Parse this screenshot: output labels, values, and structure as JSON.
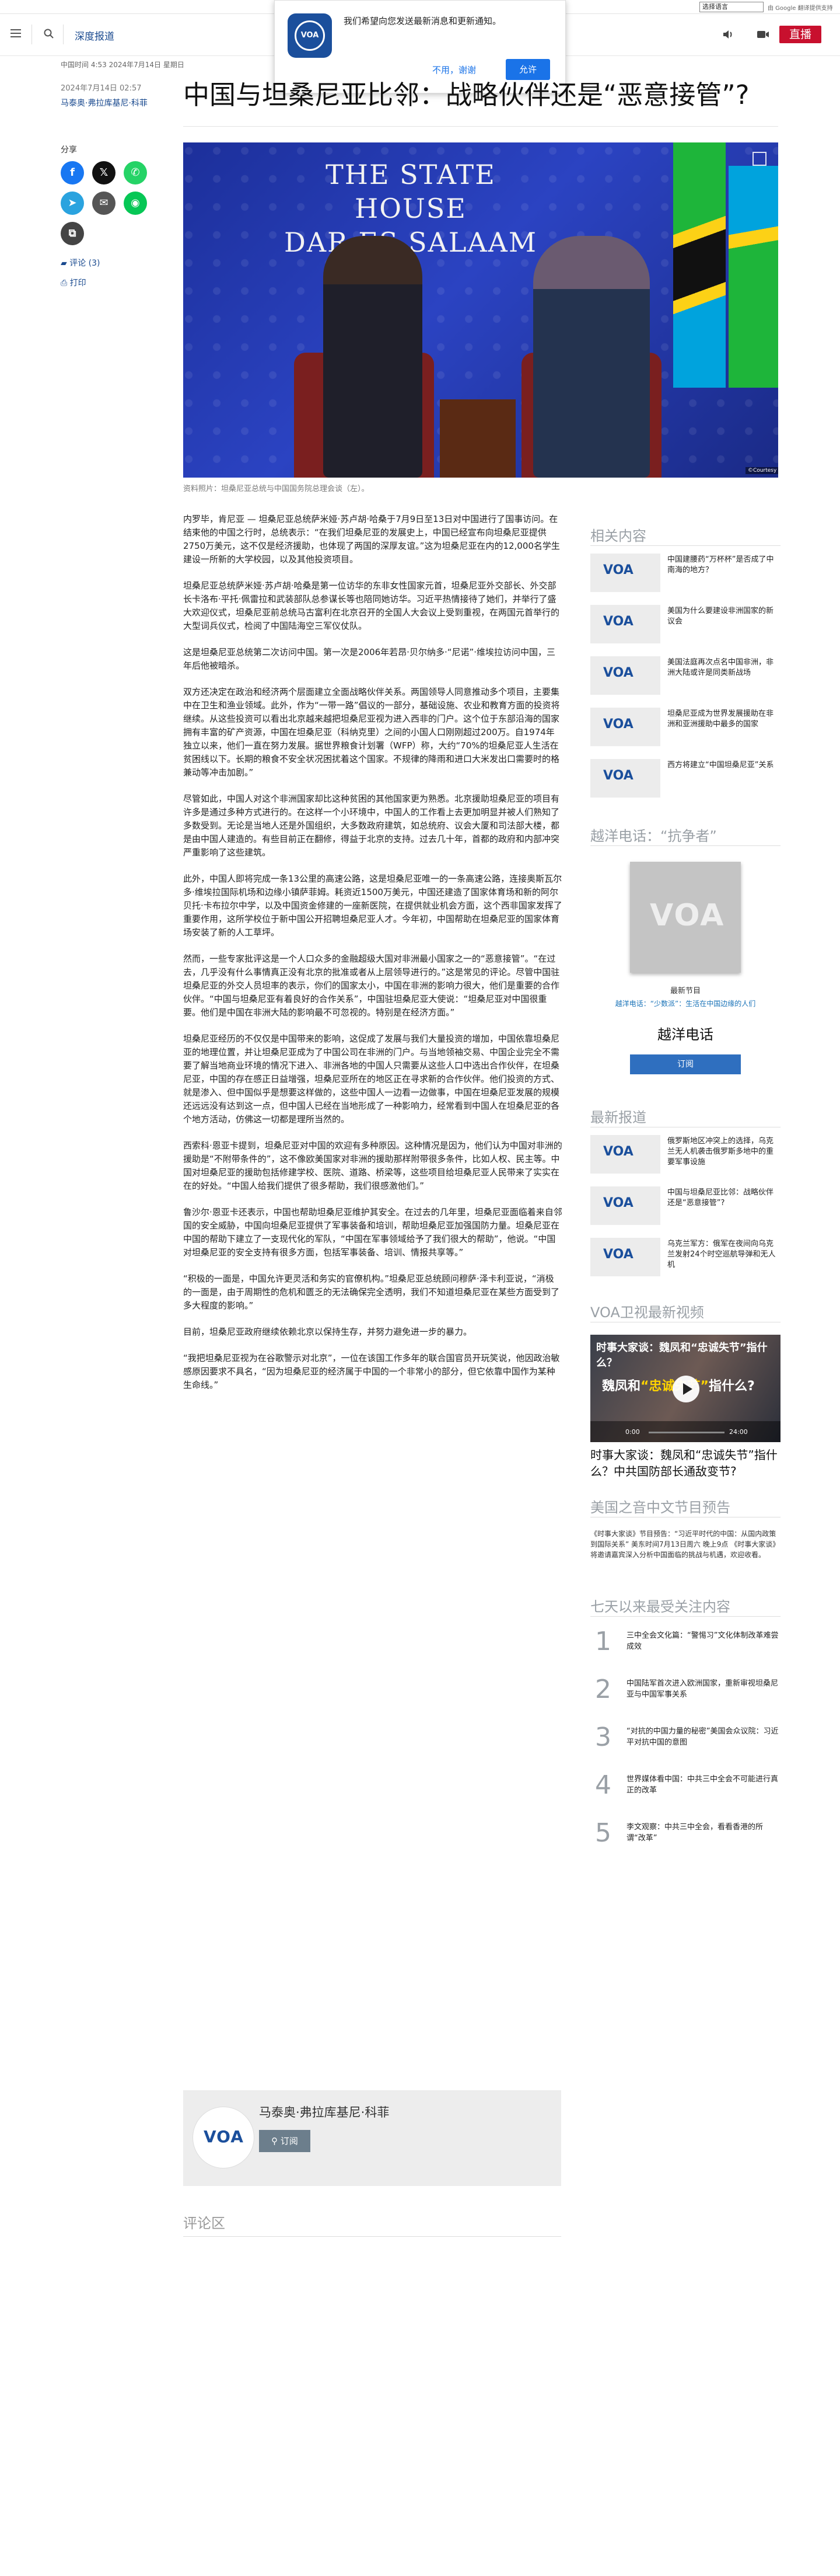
{
  "topbar": {
    "language_select": "选择语言",
    "translate_credit": "由 Google 翻译提供支持"
  },
  "header": {
    "section_label": "深度报道",
    "live_button": "直播"
  },
  "notification": {
    "logo_text": "VOA",
    "message": "我们希望向您发送最新消息和更新通知。",
    "decline": "不用，谢谢",
    "accept": "允许"
  },
  "article": {
    "dateline": "中国时间 4:53 2024年7月14日 星期日",
    "timestamp": "2024年7月14日 02:57",
    "author": "马泰奥·弗拉库基尼·科菲",
    "title": "中国与坦桑尼亚比邻：战略伙伴还是“恶意接管”?",
    "hero_sign_line1": "THE STATE HOUSE",
    "hero_sign_line2": "DAR ES SALAAM",
    "photo_credit": "©Courtesy",
    "caption": "资料照片：坦桑尼亚总统与中国国务院总理会谈（左）。",
    "paragraphs": [
      "内罗毕，肯尼亚 — 坦桑尼亚总统萨米娅·苏卢胡·哈桑于7月9日至13日对中国进行了国事访问。在结束他的中国之行时，总统表示：“在我们坦桑尼亚的发展史上，中国已经宣布向坦桑尼亚提供2750万美元，这不仅是经济援助，也体现了两国的深厚友谊。”这为坦桑尼亚在内的12,000名学生建设一所新的大学校园，以及其他投资项目。",
      "坦桑尼亚总统萨米娅·苏卢胡·哈桑是第一位访华的东非女性国家元首，坦桑尼亚外交部长、外交部长卡洛布·平托·佩雷拉和武装部队总参谋长等也陪同她访华。习近平热情接待了她们，并举行了盛大欢迎仪式，坦桑尼亚前总统马古富利在北京召开的全国人大会议上受到重视，在两国元首举行的大型词兵仪式，检阅了中国陆海空三军仪仗队。",
      "这是坦桑尼亚总统第二次访问中国。第一次是2006年若昂·贝尔纳多·“尼诺”·维埃拉访问中国，三年后他被暗杀。",
      "双方还决定在政治和经济两个层面建立全面战略伙伴关系。两国领导人同意推动多个项目，主要集中在卫生和渔业领域。此外，作为“一带一路”倡议的一部分，基础设施、农业和教育方面的投资将继续。从这些投资可以看出北京越来越把坦桑尼亚视为进入西非的门户。这个位于东部沿海的国家拥有丰富的矿产资源，中国在坦桑尼亚（科纳克里）之间的小国人口刚刚超过200万。自1974年独立以来，他们一直在努力发展。据世界粮食计划署（WFP）称，大约“70%的坦桑尼亚人生活在贫困线以下。长期的粮食不安全状况困扰着这个国家。不规律的降雨和进口大米发出口需要时的格兼动等冲击加剧。”",
      "尽管如此，中国人对这个非洲国家却比这种贫困的其他国家更为熟悉。北京援助坦桑尼亚的项目有许多是通过多种方式进行的。在这样一个小环境中，中国人的工作看上去更加明显并被人们熟知了多数受到。无论是当地人还是外国组织，大多数政府建筑，如总统府、议会大厦和司法部大楼，都是由中国人建造的。有些目前正在翻修，得益于北京的支持。过去几十年，首都的政府和内部冲突严重影响了这些建筑。",
      "此外，中国人即将完成一条13公里的高速公路，这是坦桑尼亚唯一的一条高速公路，连接奥斯瓦尔多·维埃拉国际机场和边缘小镇萨菲姆。耗资近1500万美元，中国还建造了国家体育场和新的阿尔贝托·卡布拉尔中学，以及中国资金修建的一座新医院，在提供就业机会方面，这个西非国家发挥了重要作用，这所学校位于新中国公开招聘坦桑尼亚人才。今年初，中国帮助在坦桑尼亚的国家体育场安装了新的人工草坪。",
      "然而，一些专家批评这是一个人口众多的金融超级大国对非洲最小国家之一的“恶意接管”。“在过去，几乎没有什么事情真正没有北京的批准或者从上层领导进行的。”这是常见的评论。尽管中国驻坦桑尼亚的外交人员坦率的表示，你们的国家太小，中国在非洲的影响力很大，他们是重要的合作伙伴。“中国与坦桑尼亚有着良好的合作关系”，中国驻坦桑尼亚大使说：“坦桑尼亚对中国很重要。他们是中国在非洲大陆的影响最不可忽视的。特别是在经济方面。”",
      "坦桑尼亚经历的不仅仅是中国带来的影响，这促成了发展与我们大量投资的增加，中国依靠坦桑尼亚的地理位置，并让坦桑尼亚成为了中国公司在非洲的门户。与当地领袖交易、中国企业完全不需要了解当地商业环境的情况下进入、非洲各地的中国人只需要从这些人口中选出合作伙伴，在坦桑尼亚，中国的存在感正日益增强，坦桑尼亚所在的地区正在寻求新的合作伙伴。他们投资的方式、就是渗入、但中国似乎是想要这样做的，这些中国人一边看一边做事，中国在坦桑尼亚发展的规模还远远没有达到这一点，但中国人已经在当地形成了一种影响力，经常看到中国人在坦桑尼亚的各个地方活动，仿佛这一切都是理所当然的。",
      "西索科·恩亚卡提到，坦桑尼亚对中国的欢迎有多种原因。这种情况是因为，他们认为中国对非洲的援助是“不附带条件的”，这不像欧美国家对非洲的援助那样附带很多条件，比如人权、民主等。中国对坦桑尼亚的援助包括修建学校、医院、道路、桥梁等，这些项目给坦桑尼亚人民带来了实实在在的好处。“中国人给我们提供了很多帮助，我们很感激他们。”",
      "鲁沙尔·恩亚卡还表示，中国也帮助坦桑尼亚维护其安全。在过去的几年里，坦桑尼亚面临着来自邻国的安全威胁，中国向坦桑尼亚提供了军事装备和培训，帮助坦桑尼亚加强国防力量。坦桑尼亚在中国的帮助下建立了一支现代化的军队，“中国在军事领域给予了我们很大的帮助”，他说。“中国对坦桑尼亚的安全支持有很多方面，包括军事装备、培训、情报共享等。”",
      "“积极的一面是，中国允许更灵活和务实的官僚机构。”坦桑尼亚总统顾问穆萨·泽卡利亚说，“消极的一面是，由于周期性的危机和匮乏的无法确保完全透明，我们不知道坦桑尼亚在某些方面受到了多大程度的影响。”",
      "目前，坦桑尼亚政府继续依赖北京以保持生存，并努力避免进一步的暴力。",
      "“我把坦桑尼亚视为在谷歌警示对北京”，一位在该国工作多年的联合国官员开玩笑说，他因政治敏感原因要求不具名，“因为坦桑尼亚的经济属于中国的一个非常小的部分，但它依靠中国作为某种生命线。”"
    ]
  },
  "share": {
    "label": "分享",
    "comments": "评论 (3)",
    "print": "打印"
  },
  "author_box": {
    "logo_text": "VOA",
    "name": "马泰奥·弗拉库基尼·科菲",
    "subscribe": "订阅"
  },
  "comments_heading": "评论区",
  "rail": {
    "related_heading": "相关内容",
    "related": [
      {
        "thumb": "VOA",
        "text": "中国建腰药“万杯杯”是否成了中南海的地方？"
      },
      {
        "thumb": "VOA",
        "text": "美国为什么要建设非洲国家的新议会"
      },
      {
        "thumb": "VOA",
        "text": "美国法庭再次点名中国非洲，非洲大陆或许是同类新战场"
      },
      {
        "thumb": "VOA",
        "text": "坦桑尼亚成为世界发展援助在非洲和亚洲援助中最多的国家"
      },
      {
        "thumb": "VOA",
        "text": "西方将建立“中国坦桑尼亚”关系"
      }
    ],
    "podcast_heading": "越洋电话：“抗争者”",
    "podcast_logo": "VOA",
    "podcast_label": "最新节目",
    "podcast_link": "越洋电话：“少数派”：生活在中国边缘的人们",
    "podcast_name": "越洋电话",
    "podcast_subscribe": "订阅",
    "latest_heading": "最新报道",
    "latest": [
      {
        "thumb": "VOA",
        "text": "俄罗斯地区冲突上的选择，乌克兰无人机袭击俄罗斯多地中的重要军事设施"
      },
      {
        "thumb": "VOA",
        "text": "中国与坦桑尼亚比邻：战略伙伴还是“恶意接管”?"
      },
      {
        "thumb": "VOA",
        "text": "乌克兰军方：俄军在夜间向乌克兰发射24个时空巡航导弹和无人机"
      }
    ],
    "video_heading": "VOA卫视最新视频",
    "video_overlay": "时事大家谈：魏凤和“忠诚失节”指什么？",
    "video_big_a": "魏凤和",
    "video_big_b": "“忠诚失节”",
    "video_big_c": "指什么?",
    "video_time": "0:00",
    "video_duration": "24:00",
    "video_caption": "时事大家谈：魏凤和“忠诚失节”指什么？中共国防部长通敌变节?",
    "schedule_heading": "美国之音中文节目预告",
    "schedule_text": "《时事大家谈》节目预告：“习近平时代的中国：从国内政策到国际关系” 美东时间7月13日周六 晚上9点 《时事大家谈》将邀请嘉宾深入分析中国面临的挑战与机遇，欢迎收看。",
    "popular_heading": "七天以来最受关注内容",
    "popular": [
      {
        "num": "1",
        "text": "三中全会文化篇：“警惕习”文化体制改革难尝成效"
      },
      {
        "num": "2",
        "text": "中国陆军首次进入欧洲国家，重新审视坦桑尼亚与中国军事关系"
      },
      {
        "num": "3",
        "text": "“对抗的中国力量的秘密”美国会众议院：习近平对抗中国的意图"
      },
      {
        "num": "4",
        "text": "世界媒体看中国：中共三中全会不可能进行真正的改革"
      },
      {
        "num": "5",
        "text": "李文观察：中共三中全会，看看香港的所谓“改革”"
      }
    ]
  }
}
